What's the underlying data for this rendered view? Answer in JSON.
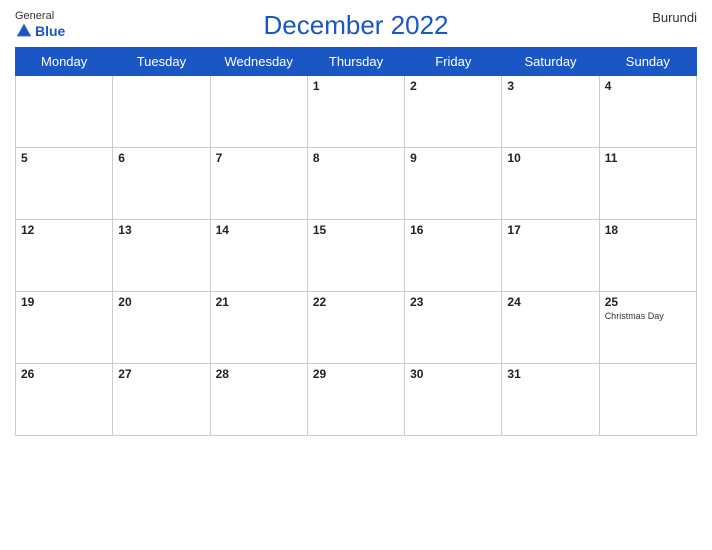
{
  "logo": {
    "general": "General",
    "blue": "Blue",
    "icon_color": "#1a56c4"
  },
  "header": {
    "title": "December 2022",
    "country": "Burundi"
  },
  "days_of_week": [
    "Monday",
    "Tuesday",
    "Wednesday",
    "Thursday",
    "Friday",
    "Saturday",
    "Sunday"
  ],
  "weeks": [
    [
      {
        "day": "",
        "empty": true
      },
      {
        "day": "",
        "empty": true
      },
      {
        "day": "",
        "empty": true
      },
      {
        "day": "1",
        "empty": false
      },
      {
        "day": "2",
        "empty": false
      },
      {
        "day": "3",
        "empty": false
      },
      {
        "day": "4",
        "empty": false
      }
    ],
    [
      {
        "day": "5",
        "empty": false
      },
      {
        "day": "6",
        "empty": false
      },
      {
        "day": "7",
        "empty": false
      },
      {
        "day": "8",
        "empty": false
      },
      {
        "day": "9",
        "empty": false
      },
      {
        "day": "10",
        "empty": false
      },
      {
        "day": "11",
        "empty": false
      }
    ],
    [
      {
        "day": "12",
        "empty": false
      },
      {
        "day": "13",
        "empty": false
      },
      {
        "day": "14",
        "empty": false
      },
      {
        "day": "15",
        "empty": false
      },
      {
        "day": "16",
        "empty": false
      },
      {
        "day": "17",
        "empty": false
      },
      {
        "day": "18",
        "empty": false
      }
    ],
    [
      {
        "day": "19",
        "empty": false
      },
      {
        "day": "20",
        "empty": false
      },
      {
        "day": "21",
        "empty": false
      },
      {
        "day": "22",
        "empty": false
      },
      {
        "day": "23",
        "empty": false
      },
      {
        "day": "24",
        "empty": false
      },
      {
        "day": "25",
        "empty": false,
        "holiday": "Christmas Day"
      }
    ],
    [
      {
        "day": "26",
        "empty": false
      },
      {
        "day": "27",
        "empty": false
      },
      {
        "day": "28",
        "empty": false
      },
      {
        "day": "29",
        "empty": false
      },
      {
        "day": "30",
        "empty": false
      },
      {
        "day": "31",
        "empty": false
      },
      {
        "day": "",
        "empty": true
      }
    ]
  ]
}
